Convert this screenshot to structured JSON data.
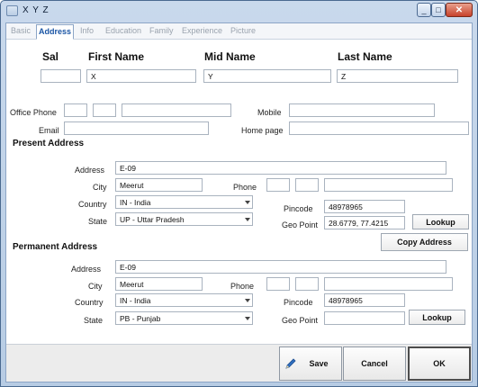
{
  "window": {
    "title": "X Y Z",
    "minimize": "_",
    "maximize": "□",
    "close": "✕"
  },
  "tabs": [
    "Basic",
    "Address",
    "Info",
    "Education",
    "Family",
    "Experience",
    "Picture"
  ],
  "active_tab": "Address",
  "name": {
    "sal_label": "Sal",
    "sal_value": "",
    "first_label": "First Name",
    "first_value": "X",
    "mid_label": "Mid Name",
    "mid_value": "Y",
    "last_label": "Last Name",
    "last_value": "Z"
  },
  "contact": {
    "office_phone_label": "Office Phone",
    "office_phone_parts": [
      "",
      "",
      ""
    ],
    "mobile_label": "Mobile",
    "mobile_value": "",
    "email_label": "Email",
    "email_value": "",
    "homepage_label": "Home page",
    "homepage_value": ""
  },
  "present": {
    "title": "Present Address",
    "address_label": "Address",
    "address_value": "E-09",
    "city_label": "City",
    "city_value": "Meerut",
    "phone_label": "Phone",
    "phone_parts": [
      "",
      "",
      ""
    ],
    "country_label": "Country",
    "country_value": "IN - India",
    "pincode_label": "Pincode",
    "pincode_value": "48978965",
    "state_label": "State",
    "state_value": "UP - Uttar Pradesh",
    "geo_label": "Geo Point",
    "geo_value": "28.6779, 77.4215",
    "lookup_label": "Lookup",
    "copy_label": "Copy Address"
  },
  "permanent": {
    "title": "Permanent Address",
    "address_label": "Address",
    "address_value": "E-09",
    "city_label": "City",
    "city_value": "Meerut",
    "phone_label": "Phone",
    "phone_parts": [
      "",
      "",
      ""
    ],
    "country_label": "Country",
    "country_value": "IN - India",
    "pincode_label": "Pincode",
    "pincode_value": "48978965",
    "state_label": "State",
    "state_value": "PB - Punjab",
    "geo_label": "Geo Point",
    "geo_value": "",
    "lookup_label": "Lookup"
  },
  "footer": {
    "save_label": "Save",
    "cancel_label": "Cancel",
    "ok_label": "OK"
  },
  "colors": {
    "active_tab": "#1a55a5",
    "window_frame": "#b7cce4",
    "close_button": "#c7412a"
  }
}
